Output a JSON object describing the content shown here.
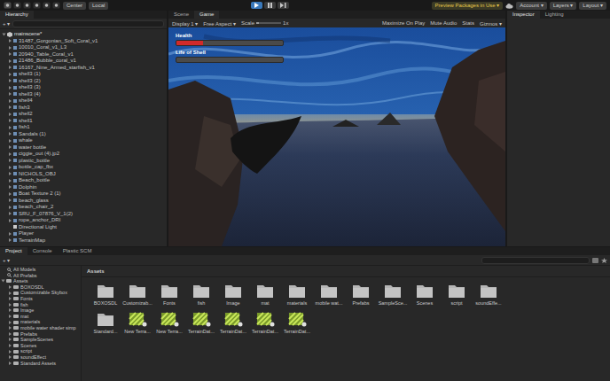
{
  "toolbar": {
    "pivot": "Center",
    "space": "Local",
    "playing": true,
    "packages": "Preview Packages in Use ▾",
    "account": "Account ▾",
    "layers": "Layers ▾",
    "layout": "Layout ▾"
  },
  "hierarchy": {
    "tab": "Hierarchy",
    "add": "+ ▾",
    "scene": "mainscene*",
    "items": [
      {
        "label": "31487_Gorgonian_Soft_Coral_v1",
        "expandable": true
      },
      {
        "label": "10010_Coral_v1_L3",
        "expandable": true
      },
      {
        "label": "20940_Table_Coral_v1",
        "expandable": true
      },
      {
        "label": "21486_Bubble_coral_v1",
        "expandable": true
      },
      {
        "label": "16167_Nine_Armed_starfish_v1",
        "expandable": true
      },
      {
        "label": "shell3 (1)",
        "expandable": true
      },
      {
        "label": "shell3 (2)",
        "expandable": true
      },
      {
        "label": "shell3 (3)",
        "expandable": true
      },
      {
        "label": "shell3 (4)",
        "expandable": true
      },
      {
        "label": "shell4",
        "expandable": true
      },
      {
        "label": "fish3",
        "expandable": true
      },
      {
        "label": "shell2",
        "expandable": true
      },
      {
        "label": "shell1",
        "expandable": true
      },
      {
        "label": "fish1",
        "expandable": true
      },
      {
        "label": "Sandals (1)",
        "expandable": true
      },
      {
        "label": "whale",
        "expandable": true
      },
      {
        "label": "water bottle",
        "expandable": true
      },
      {
        "label": "ciggie_out (4).jp2",
        "expandable": true
      },
      {
        "label": "plastic_bottle",
        "expandable": true
      },
      {
        "label": "bottle_cap_fbx",
        "expandable": true
      },
      {
        "label": "NICHOLS_OBJ",
        "expandable": true
      },
      {
        "label": "Beach_bottle",
        "expandable": true
      },
      {
        "label": "Dolphin",
        "expandable": true
      },
      {
        "label": "Boat Texture 2 (1)",
        "expandable": true
      },
      {
        "label": "beach_glass",
        "expandable": true
      },
      {
        "label": "beach_chair_2",
        "expandable": true
      },
      {
        "label": "SRU_F_07876_V_1(2)",
        "expandable": true
      },
      {
        "label": "rope_anchor_DRI",
        "expandable": true
      },
      {
        "label": "Directional Light",
        "expandable": false
      },
      {
        "label": "Player",
        "expandable": true
      },
      {
        "label": "TerrainMap",
        "expandable": true
      }
    ]
  },
  "game_view": {
    "tabs": [
      {
        "label": "Scene",
        "selected": false
      },
      {
        "label": "Game",
        "selected": true
      }
    ],
    "display": "Display 1 ▾",
    "aspect": "Free Aspect ▾",
    "scale_label": "Scale",
    "scale_level": 0.1,
    "scale_value": "1x",
    "options": [
      "Maximize On Play",
      "Mute Audio",
      "Stats",
      "Gizmos ▾"
    ],
    "hud": [
      {
        "label": "Health",
        "level": 0.25,
        "color": "#d02a2a"
      },
      {
        "label": "Life of Shell",
        "level": 0,
        "color": "#4f8f3a"
      }
    ]
  },
  "inspector": {
    "tabs": [
      {
        "label": "Inspector",
        "selected": true
      },
      {
        "label": "Lighting",
        "selected": false
      }
    ]
  },
  "project": {
    "tabs": [
      {
        "label": "Project",
        "selected": true
      },
      {
        "label": "Console",
        "selected": false
      },
      {
        "label": "Plastic SCM",
        "selected": false
      }
    ],
    "add": "+ ▾",
    "tree": [
      {
        "label": "All Models",
        "kind": "filter"
      },
      {
        "label": "All Prefabs",
        "kind": "filter"
      },
      {
        "label": "Assets",
        "kind": "root"
      },
      {
        "label": "BOXOSDL",
        "kind": "folder"
      },
      {
        "label": "Customizable Skybox",
        "kind": "folder"
      },
      {
        "label": "Fonts",
        "kind": "folder"
      },
      {
        "label": "fish",
        "kind": "folder"
      },
      {
        "label": "Image",
        "kind": "folder"
      },
      {
        "label": "mat",
        "kind": "folder"
      },
      {
        "label": "materials",
        "kind": "folder"
      },
      {
        "label": "mobile water shader simp",
        "kind": "folder"
      },
      {
        "label": "Prefabs",
        "kind": "folder"
      },
      {
        "label": "SampleScenes",
        "kind": "folder"
      },
      {
        "label": "Scenes",
        "kind": "folder"
      },
      {
        "label": "script",
        "kind": "folder"
      },
      {
        "label": "soundEffect",
        "kind": "folder"
      },
      {
        "label": "Standard Assets",
        "kind": "folder"
      }
    ],
    "breadcrumb": "Assets",
    "assets": [
      {
        "label": "BOXOSDL",
        "kind": "folder"
      },
      {
        "label": "Customizab...",
        "kind": "folder"
      },
      {
        "label": "Fonts",
        "kind": "folder"
      },
      {
        "label": "fish",
        "kind": "folder"
      },
      {
        "label": "Image",
        "kind": "folder"
      },
      {
        "label": "mat",
        "kind": "folder"
      },
      {
        "label": "materials",
        "kind": "folder"
      },
      {
        "label": "mobile wat...",
        "kind": "folder"
      },
      {
        "label": "Prefabs",
        "kind": "folder"
      },
      {
        "label": "SampleSce...",
        "kind": "folder"
      },
      {
        "label": "Scenes",
        "kind": "folder"
      },
      {
        "label": "script",
        "kind": "folder"
      },
      {
        "label": "soundEffe...",
        "kind": "folder"
      },
      {
        "label": "Standard...",
        "kind": "folder"
      },
      {
        "label": "New Terra...",
        "kind": "terrain"
      },
      {
        "label": "New Terra...",
        "kind": "terrain"
      },
      {
        "label": "TerrainDat...",
        "kind": "terrain"
      },
      {
        "label": "TerrainDat...",
        "kind": "terrain"
      },
      {
        "label": "TerrainDat...",
        "kind": "terrain"
      },
      {
        "label": "TerrainDat...",
        "kind": "terrain"
      }
    ]
  }
}
